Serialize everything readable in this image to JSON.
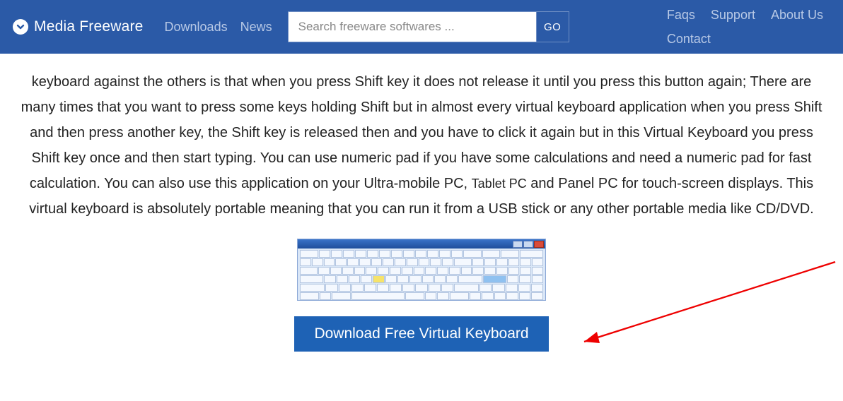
{
  "header": {
    "brand": "Media Freeware",
    "nav1": [
      "Downloads",
      "News"
    ],
    "search_placeholder": "Search freeware softwares ...",
    "go_label": "GO",
    "nav2_row1": [
      "Faqs",
      "Support",
      "About Us"
    ],
    "nav2_row2": [
      "Contact"
    ]
  },
  "body": {
    "para_pre": "keyboard against the others is that when you press Shift key it does not release it until you press this button again; There are many times that you want to press some keys holding Shift but in almost every virtual keyboard application when you press Shift and then press another key, the Shift key is released then and you have to click it again but in this Virtual Keyboard you press Shift key once and then start typing. You can use numeric pad if you have some calculations and need a numeric pad for fast calculation. You can also use this application on your Ultra-mobile PC, ",
    "tabletpc": "Tablet PC",
    "para_post": " and Panel PC for touch-screen displays. This virtual keyboard is absolutely portable meaning that you can run it from a USB stick or any other portable media like CD/DVD."
  },
  "download_label": "Download Free Virtual Keyboard"
}
